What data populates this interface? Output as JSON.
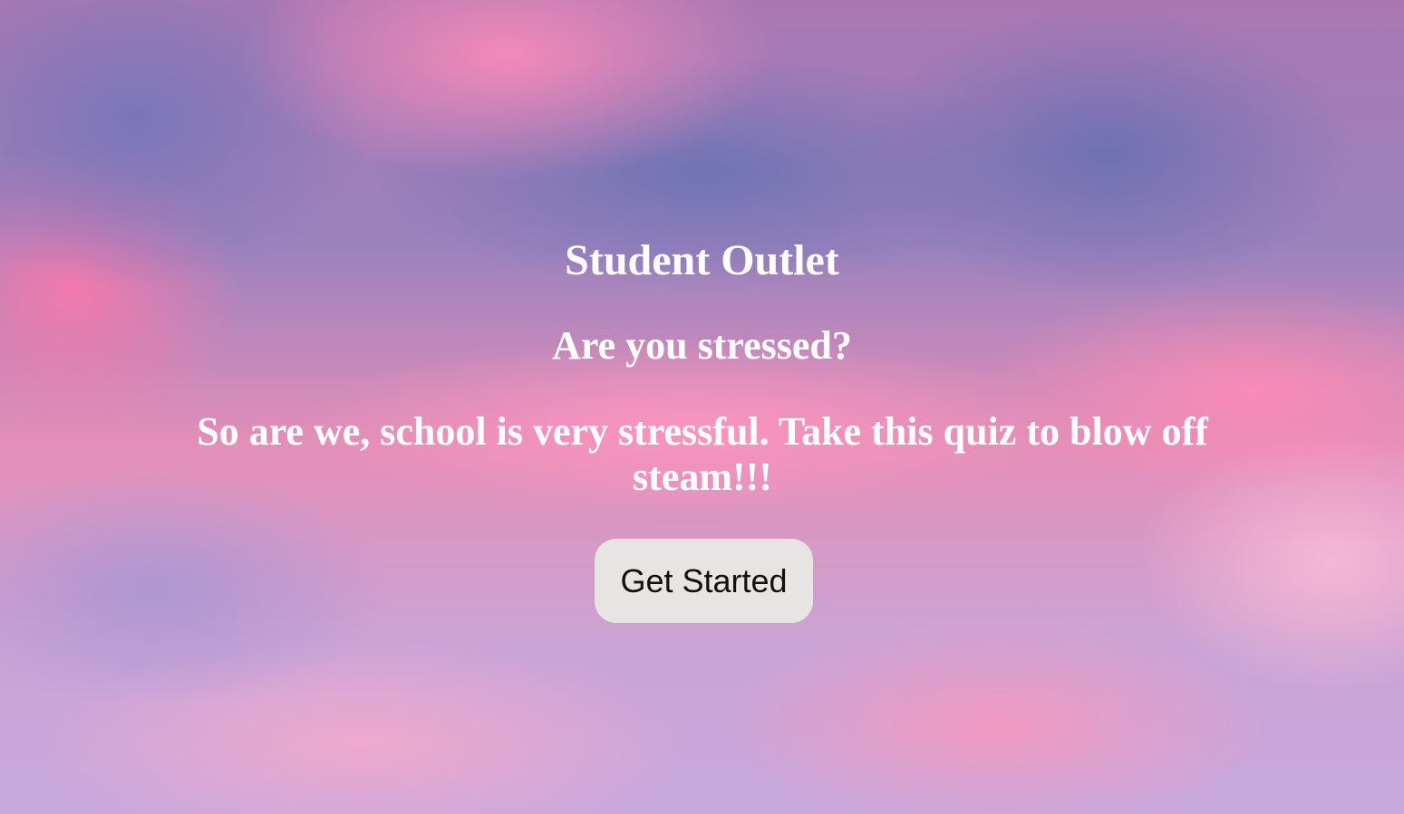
{
  "hero": {
    "title": "Student Outlet",
    "subtitle": "Are you stressed?",
    "tagline": "So are we, school is very stressful. Take this quiz to blow off steam!!!",
    "button_label": "Get Started"
  },
  "colors": {
    "text": "#ffffff",
    "button_background": "#e9e4e4",
    "button_text": "#111111",
    "sky_pink": "#e48fb8",
    "sky_purple": "#9b82bd"
  }
}
